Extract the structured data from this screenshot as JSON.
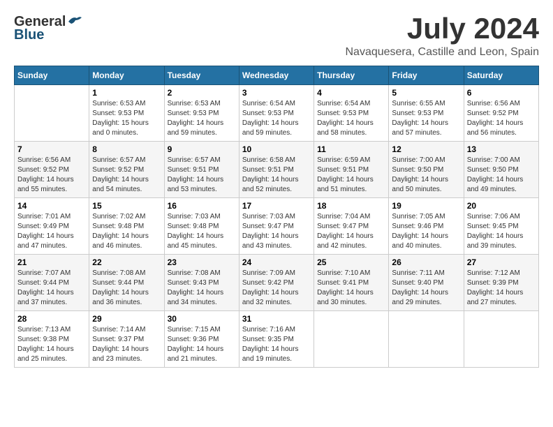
{
  "logo": {
    "general": "General",
    "blue": "Blue"
  },
  "title": {
    "month_year": "July 2024",
    "location": "Navaquesera, Castille and Leon, Spain"
  },
  "calendar": {
    "headers": [
      "Sunday",
      "Monday",
      "Tuesday",
      "Wednesday",
      "Thursday",
      "Friday",
      "Saturday"
    ],
    "weeks": [
      [
        {
          "day": "",
          "sunrise": "",
          "sunset": "",
          "daylight": ""
        },
        {
          "day": "1",
          "sunrise": "Sunrise: 6:53 AM",
          "sunset": "Sunset: 9:53 PM",
          "daylight": "Daylight: 15 hours and 0 minutes."
        },
        {
          "day": "2",
          "sunrise": "Sunrise: 6:53 AM",
          "sunset": "Sunset: 9:53 PM",
          "daylight": "Daylight: 14 hours and 59 minutes."
        },
        {
          "day": "3",
          "sunrise": "Sunrise: 6:54 AM",
          "sunset": "Sunset: 9:53 PM",
          "daylight": "Daylight: 14 hours and 59 minutes."
        },
        {
          "day": "4",
          "sunrise": "Sunrise: 6:54 AM",
          "sunset": "Sunset: 9:53 PM",
          "daylight": "Daylight: 14 hours and 58 minutes."
        },
        {
          "day": "5",
          "sunrise": "Sunrise: 6:55 AM",
          "sunset": "Sunset: 9:53 PM",
          "daylight": "Daylight: 14 hours and 57 minutes."
        },
        {
          "day": "6",
          "sunrise": "Sunrise: 6:56 AM",
          "sunset": "Sunset: 9:52 PM",
          "daylight": "Daylight: 14 hours and 56 minutes."
        }
      ],
      [
        {
          "day": "7",
          "sunrise": "Sunrise: 6:56 AM",
          "sunset": "Sunset: 9:52 PM",
          "daylight": "Daylight: 14 hours and 55 minutes."
        },
        {
          "day": "8",
          "sunrise": "Sunrise: 6:57 AM",
          "sunset": "Sunset: 9:52 PM",
          "daylight": "Daylight: 14 hours and 54 minutes."
        },
        {
          "day": "9",
          "sunrise": "Sunrise: 6:57 AM",
          "sunset": "Sunset: 9:51 PM",
          "daylight": "Daylight: 14 hours and 53 minutes."
        },
        {
          "day": "10",
          "sunrise": "Sunrise: 6:58 AM",
          "sunset": "Sunset: 9:51 PM",
          "daylight": "Daylight: 14 hours and 52 minutes."
        },
        {
          "day": "11",
          "sunrise": "Sunrise: 6:59 AM",
          "sunset": "Sunset: 9:51 PM",
          "daylight": "Daylight: 14 hours and 51 minutes."
        },
        {
          "day": "12",
          "sunrise": "Sunrise: 7:00 AM",
          "sunset": "Sunset: 9:50 PM",
          "daylight": "Daylight: 14 hours and 50 minutes."
        },
        {
          "day": "13",
          "sunrise": "Sunrise: 7:00 AM",
          "sunset": "Sunset: 9:50 PM",
          "daylight": "Daylight: 14 hours and 49 minutes."
        }
      ],
      [
        {
          "day": "14",
          "sunrise": "Sunrise: 7:01 AM",
          "sunset": "Sunset: 9:49 PM",
          "daylight": "Daylight: 14 hours and 47 minutes."
        },
        {
          "day": "15",
          "sunrise": "Sunrise: 7:02 AM",
          "sunset": "Sunset: 9:48 PM",
          "daylight": "Daylight: 14 hours and 46 minutes."
        },
        {
          "day": "16",
          "sunrise": "Sunrise: 7:03 AM",
          "sunset": "Sunset: 9:48 PM",
          "daylight": "Daylight: 14 hours and 45 minutes."
        },
        {
          "day": "17",
          "sunrise": "Sunrise: 7:03 AM",
          "sunset": "Sunset: 9:47 PM",
          "daylight": "Daylight: 14 hours and 43 minutes."
        },
        {
          "day": "18",
          "sunrise": "Sunrise: 7:04 AM",
          "sunset": "Sunset: 9:47 PM",
          "daylight": "Daylight: 14 hours and 42 minutes."
        },
        {
          "day": "19",
          "sunrise": "Sunrise: 7:05 AM",
          "sunset": "Sunset: 9:46 PM",
          "daylight": "Daylight: 14 hours and 40 minutes."
        },
        {
          "day": "20",
          "sunrise": "Sunrise: 7:06 AM",
          "sunset": "Sunset: 9:45 PM",
          "daylight": "Daylight: 14 hours and 39 minutes."
        }
      ],
      [
        {
          "day": "21",
          "sunrise": "Sunrise: 7:07 AM",
          "sunset": "Sunset: 9:44 PM",
          "daylight": "Daylight: 14 hours and 37 minutes."
        },
        {
          "day": "22",
          "sunrise": "Sunrise: 7:08 AM",
          "sunset": "Sunset: 9:44 PM",
          "daylight": "Daylight: 14 hours and 36 minutes."
        },
        {
          "day": "23",
          "sunrise": "Sunrise: 7:08 AM",
          "sunset": "Sunset: 9:43 PM",
          "daylight": "Daylight: 14 hours and 34 minutes."
        },
        {
          "day": "24",
          "sunrise": "Sunrise: 7:09 AM",
          "sunset": "Sunset: 9:42 PM",
          "daylight": "Daylight: 14 hours and 32 minutes."
        },
        {
          "day": "25",
          "sunrise": "Sunrise: 7:10 AM",
          "sunset": "Sunset: 9:41 PM",
          "daylight": "Daylight: 14 hours and 30 minutes."
        },
        {
          "day": "26",
          "sunrise": "Sunrise: 7:11 AM",
          "sunset": "Sunset: 9:40 PM",
          "daylight": "Daylight: 14 hours and 29 minutes."
        },
        {
          "day": "27",
          "sunrise": "Sunrise: 7:12 AM",
          "sunset": "Sunset: 9:39 PM",
          "daylight": "Daylight: 14 hours and 27 minutes."
        }
      ],
      [
        {
          "day": "28",
          "sunrise": "Sunrise: 7:13 AM",
          "sunset": "Sunset: 9:38 PM",
          "daylight": "Daylight: 14 hours and 25 minutes."
        },
        {
          "day": "29",
          "sunrise": "Sunrise: 7:14 AM",
          "sunset": "Sunset: 9:37 PM",
          "daylight": "Daylight: 14 hours and 23 minutes."
        },
        {
          "day": "30",
          "sunrise": "Sunrise: 7:15 AM",
          "sunset": "Sunset: 9:36 PM",
          "daylight": "Daylight: 14 hours and 21 minutes."
        },
        {
          "day": "31",
          "sunrise": "Sunrise: 7:16 AM",
          "sunset": "Sunset: 9:35 PM",
          "daylight": "Daylight: 14 hours and 19 minutes."
        },
        {
          "day": "",
          "sunrise": "",
          "sunset": "",
          "daylight": ""
        },
        {
          "day": "",
          "sunrise": "",
          "sunset": "",
          "daylight": ""
        },
        {
          "day": "",
          "sunrise": "",
          "sunset": "",
          "daylight": ""
        }
      ]
    ]
  }
}
